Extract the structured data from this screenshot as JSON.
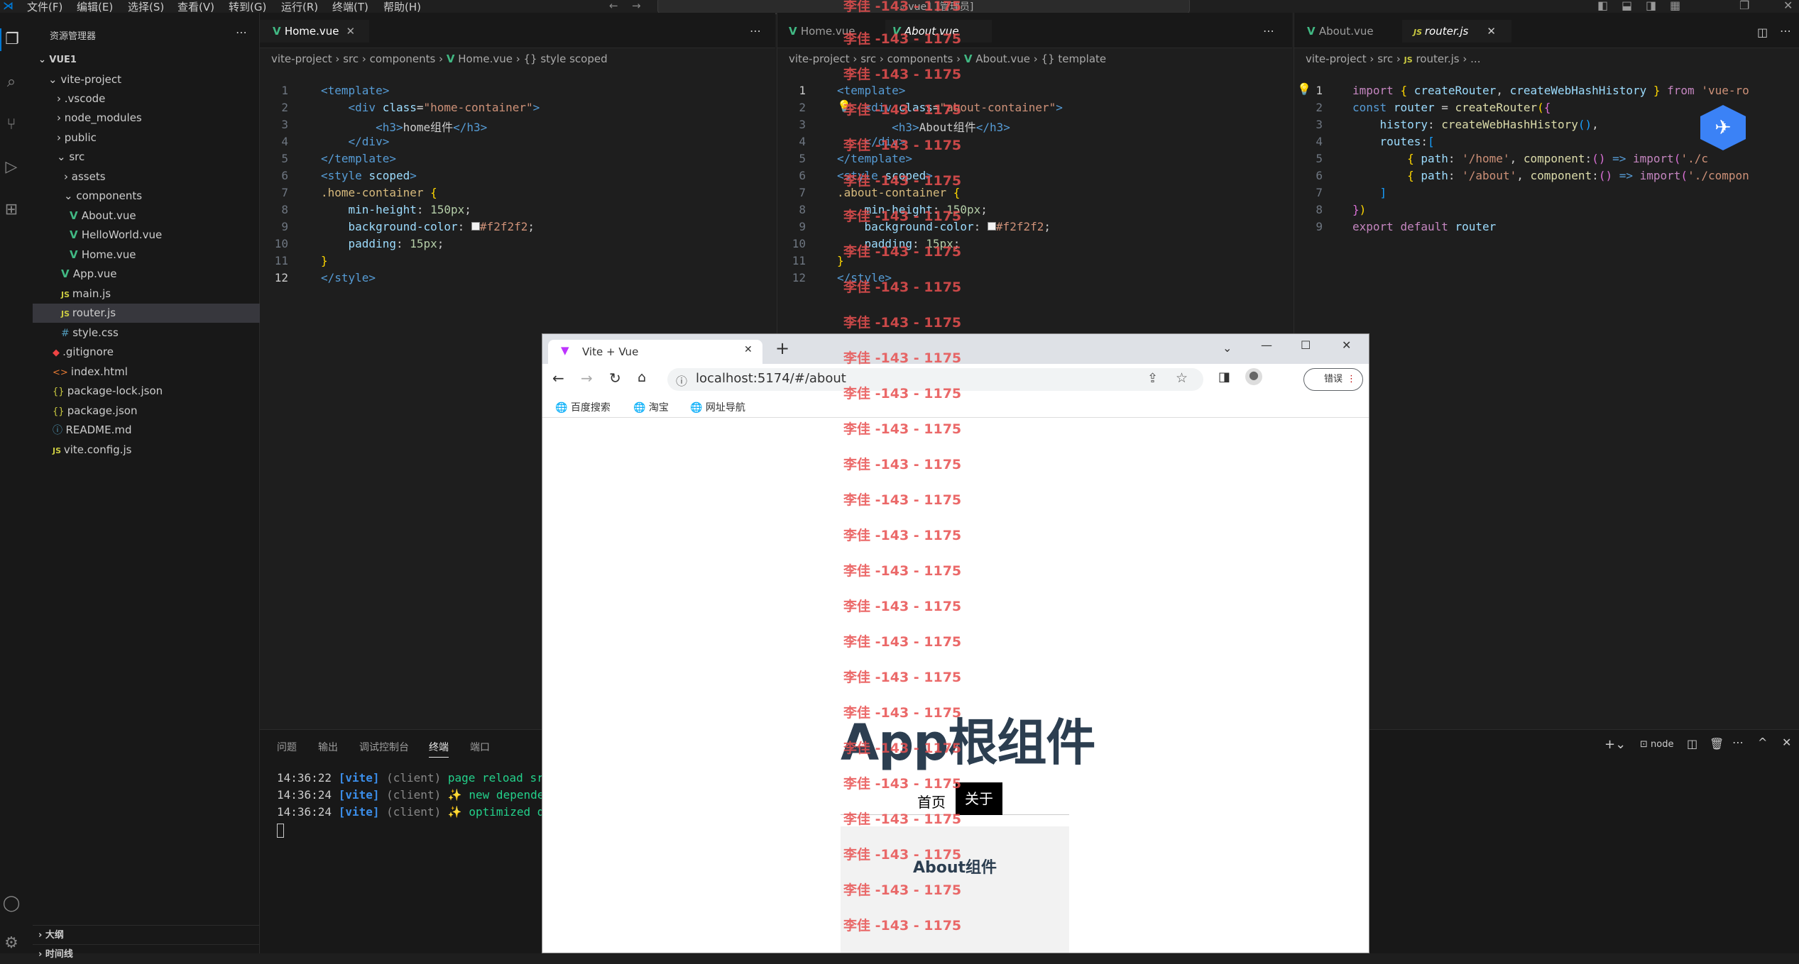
{
  "menubar": {
    "items": [
      "文件(F)",
      "编辑(E)",
      "选择(S)",
      "查看(V)",
      "转到(G)",
      "运行(R)",
      "终端(T)",
      "帮助(H)"
    ],
    "search": "vue1 [管理员]"
  },
  "explorer": {
    "title": "资源管理器",
    "root": "VUE1",
    "items": [
      {
        "label": "vite-project"
      },
      {
        "label": ".vscode"
      },
      {
        "label": "node_modules"
      },
      {
        "label": "public"
      },
      {
        "label": "src"
      },
      {
        "label": "assets"
      },
      {
        "label": "components"
      },
      {
        "label": "About.vue"
      },
      {
        "label": "HelloWorld.vue"
      },
      {
        "label": "Home.vue"
      },
      {
        "label": "App.vue"
      },
      {
        "label": "main.js"
      },
      {
        "label": "router.js"
      },
      {
        "label": "style.css"
      },
      {
        "label": ".gitignore"
      },
      {
        "label": "index.html"
      },
      {
        "label": "package-lock.json"
      },
      {
        "label": "package.json"
      },
      {
        "label": "README.md"
      },
      {
        "label": "vite.config.js"
      }
    ],
    "outline": "大纲",
    "timeline": "时间线"
  },
  "editor1": {
    "tab": "Home.vue",
    "crumbs": [
      "vite-project",
      "src",
      "components",
      "Home.vue",
      "{} style scoped"
    ],
    "lines": 12
  },
  "editor2": {
    "tab_inactive": "Home.vue",
    "tab": "About.vue",
    "crumbs": [
      "vite-project",
      "src",
      "components",
      "About.vue",
      "{} template"
    ]
  },
  "editor3": {
    "tab_inactive": "About.vue",
    "tab": "router.js",
    "crumbs": [
      "vite-project",
      "src",
      "router.js",
      "..."
    ]
  },
  "panel": {
    "tabs": [
      "问题",
      "输出",
      "调试控制台",
      "终端",
      "端口"
    ],
    "active_tab": "终端",
    "shell": "node",
    "lines": [
      {
        "time": "14:36:22",
        "tag": "[vite]",
        "src": "(client)",
        "msg": "page reload src/"
      },
      {
        "time": "14:36:24",
        "tag": "[vite]",
        "src": "(client)",
        "msg": "✨ new dependenc"
      },
      {
        "time": "14:36:24",
        "tag": "[vite]",
        "src": "(client)",
        "msg": "✨ optimized dep"
      }
    ]
  },
  "browser": {
    "tab_title": "Vite + Vue",
    "url": "localhost:5174/#/about",
    "bookmarks": [
      "百度搜索",
      "淘宝",
      "网址导航"
    ],
    "error_button": "错误",
    "page": {
      "title": "App根组件",
      "nav": {
        "home": "首页",
        "about": "关于"
      },
      "about_heading": "About组件"
    }
  },
  "watermark": "李佳 -143 - 1175",
  "colors": {
    "accent": "#0078d4",
    "vue": "#41b883",
    "watermark": "#e85050",
    "nav_active_bg": "#000000",
    "about_bg": "#f2f2f2"
  }
}
